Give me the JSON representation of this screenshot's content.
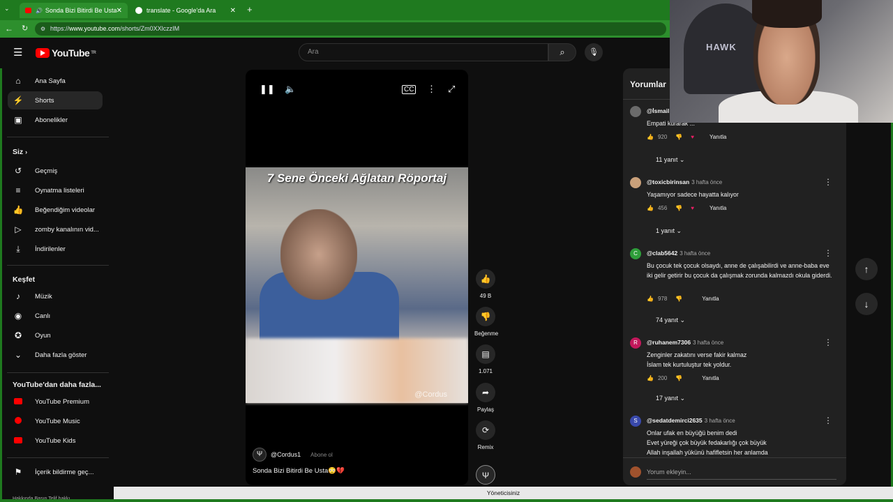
{
  "browser": {
    "tabs": [
      {
        "label": "Sonda Bizi Bitirdi Be Usta😳💔",
        "active": true
      },
      {
        "label": "translate - Google'da Ara",
        "active": false
      }
    ],
    "url_prefix": "https://",
    "url_host": "www.youtube.com",
    "url_path": "/shorts/Zm0XXlczzIM"
  },
  "header": {
    "logo_text": "YouTube",
    "region": "TR",
    "search_placeholder": "Ara"
  },
  "sidebar": {
    "main": [
      {
        "label": "Ana Sayfa",
        "icon": "home-icon"
      },
      {
        "label": "Shorts",
        "icon": "shorts-icon"
      },
      {
        "label": "Abonelikler",
        "icon": "subscriptions-icon"
      }
    ],
    "you_heading": "Siz",
    "you": [
      {
        "label": "Geçmiş",
        "icon": "history-icon"
      },
      {
        "label": "Oynatma listeleri",
        "icon": "playlist-icon"
      },
      {
        "label": "Beğendiğim videolar",
        "icon": "like-icon"
      },
      {
        "label": "zomby kanalının vid...",
        "icon": "video-icon"
      },
      {
        "label": "İndirilenler",
        "icon": "download-icon"
      }
    ],
    "explore_heading": "Keşfet",
    "explore": [
      {
        "label": "Müzik",
        "icon": "music-icon"
      },
      {
        "label": "Canlı",
        "icon": "live-icon"
      },
      {
        "label": "Oyun",
        "icon": "gaming-icon"
      },
      {
        "label": "Daha fazla göster",
        "icon": "chevron-down-icon"
      }
    ],
    "more_heading": "YouTube'dan daha fazla...",
    "more": [
      {
        "label": "YouTube Premium"
      },
      {
        "label": "YouTube Music"
      },
      {
        "label": "YouTube Kids"
      }
    ],
    "report": "İçerik bildirme geç...",
    "footer": "Hakkında  Basın  Telif hakkı"
  },
  "player": {
    "video_title_overlay": "7 Sene Önceki Ağlatan Röportaj",
    "watermark": "@Cordus",
    "channel": "@Cordus1",
    "subscribe": "Abone ol",
    "caption": "Sonda Bizi Bitirdi Be Usta😳💔"
  },
  "actions": {
    "likes": "49 B",
    "dislike": "Beğenme",
    "comments": "1.071",
    "share": "Paylaş",
    "remix": "Remix"
  },
  "comments": {
    "heading": "Yorumlar",
    "items": [
      {
        "user": "@İsmail",
        "time": "",
        "text": "Empati kurarak ...",
        "likes": "920",
        "reply": "Yanıtla",
        "replies": "11 yanıt",
        "avatar_color": "#6b6b6b",
        "initial": ""
      },
      {
        "user": "@toxicbirinsan",
        "time": "3 hafta önce",
        "text": "Yaşamıyor sadece hayatta kalıyor",
        "likes": "456",
        "reply": "Yanıtla",
        "replies": "1 yanıt",
        "avatar_color": "#c9a07a",
        "initial": ""
      },
      {
        "user": "@clab5642",
        "time": "3 hafta önce",
        "text": "Bu çocuk tek çocuk olsaydı, anne de çalışabilirdi ve anne-baba eve iki gelir getirir bu çocuk da çalışmak zorunda kalmazdı okula giderdi.",
        "likes": "978",
        "reply": "Yanıtla",
        "replies": "74 yanıt",
        "avatar_color": "#2e9e3a",
        "initial": "C"
      },
      {
        "user": "@ruhanem7306",
        "time": "3 hafta önce",
        "text": "Zenginler zakatını verse fakir kalmaz\nİslam tek kurtuluştur tek yoldur.",
        "likes": "200",
        "reply": "Yanıtla",
        "replies": "17 yanıt",
        "avatar_color": "#c2185b",
        "initial": "R"
      },
      {
        "user": "@sedatdemirci2635",
        "time": "3 hafta önce",
        "text": "Onlar ufak en büyüğü benim dedi\nEvet yüreği çok büyük fedakarlığı çok büyük\nAllah inşallah yükünü hafifletsin her anlamda",
        "likes": "",
        "reply": "",
        "replies": "",
        "avatar_color": "#3949ab",
        "initial": "S"
      }
    ],
    "input_placeholder": "Yorum ekleyin..."
  },
  "webcam": {
    "cap_text": "HAWK"
  },
  "status_bar": "Yöneticisiniz"
}
